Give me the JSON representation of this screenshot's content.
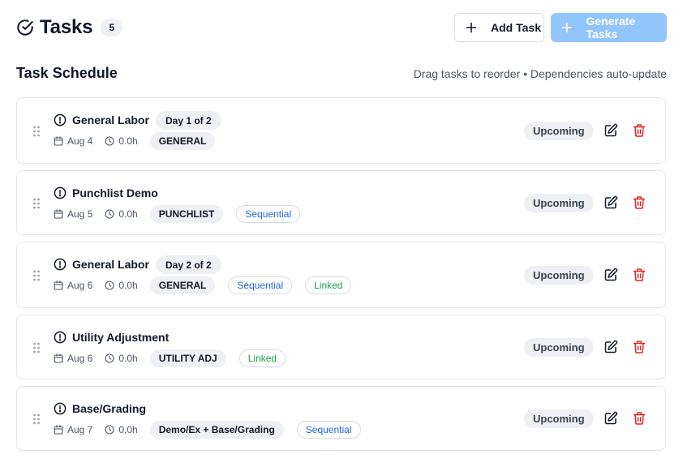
{
  "header": {
    "title": "Tasks",
    "count": "5",
    "add_label": "Add Task",
    "generate_label": "Generate Tasks"
  },
  "section": {
    "title": "Task Schedule",
    "hint": "Drag tasks to reorder • Dependencies auto-update"
  },
  "tasks": [
    {
      "name": "General Labor",
      "day": "Day 1 of 2",
      "date": "Aug 4",
      "hours": "0.0h",
      "type": "GENERAL",
      "sequential": "",
      "linked": "",
      "status": "Upcoming"
    },
    {
      "name": "Punchlist Demo",
      "day": "",
      "date": "Aug 5",
      "hours": "0.0h",
      "type": "PUNCHLIST",
      "sequential": "Sequential",
      "linked": "",
      "status": "Upcoming"
    },
    {
      "name": "General Labor",
      "day": "Day 2 of 2",
      "date": "Aug 6",
      "hours": "0.0h",
      "type": "GENERAL",
      "sequential": "Sequential",
      "linked": "Linked",
      "status": "Upcoming"
    },
    {
      "name": "Utility Adjustment",
      "day": "",
      "date": "Aug 6",
      "hours": "0.0h",
      "type": "UTILITY ADJ",
      "sequential": "",
      "linked": "Linked",
      "status": "Upcoming"
    },
    {
      "name": "Base/Grading",
      "day": "",
      "date": "Aug 7",
      "hours": "0.0h",
      "type": "Demo/Ex + Base/Grading",
      "sequential": "Sequential",
      "linked": "",
      "status": "Upcoming"
    }
  ],
  "colors": {
    "accent_blue": "#2563eb",
    "generate_button": "#93c5fd",
    "linked_green": "#16a34a",
    "delete_red": "#dc2626"
  },
  "icons": {
    "title": "check-circle-icon",
    "add": "plus-icon",
    "task": "alert-circle-icon",
    "drag": "grip-vertical-icon",
    "date": "calendar-icon",
    "hours": "clock-icon",
    "edit": "edit-icon",
    "delete": "trash-icon"
  }
}
